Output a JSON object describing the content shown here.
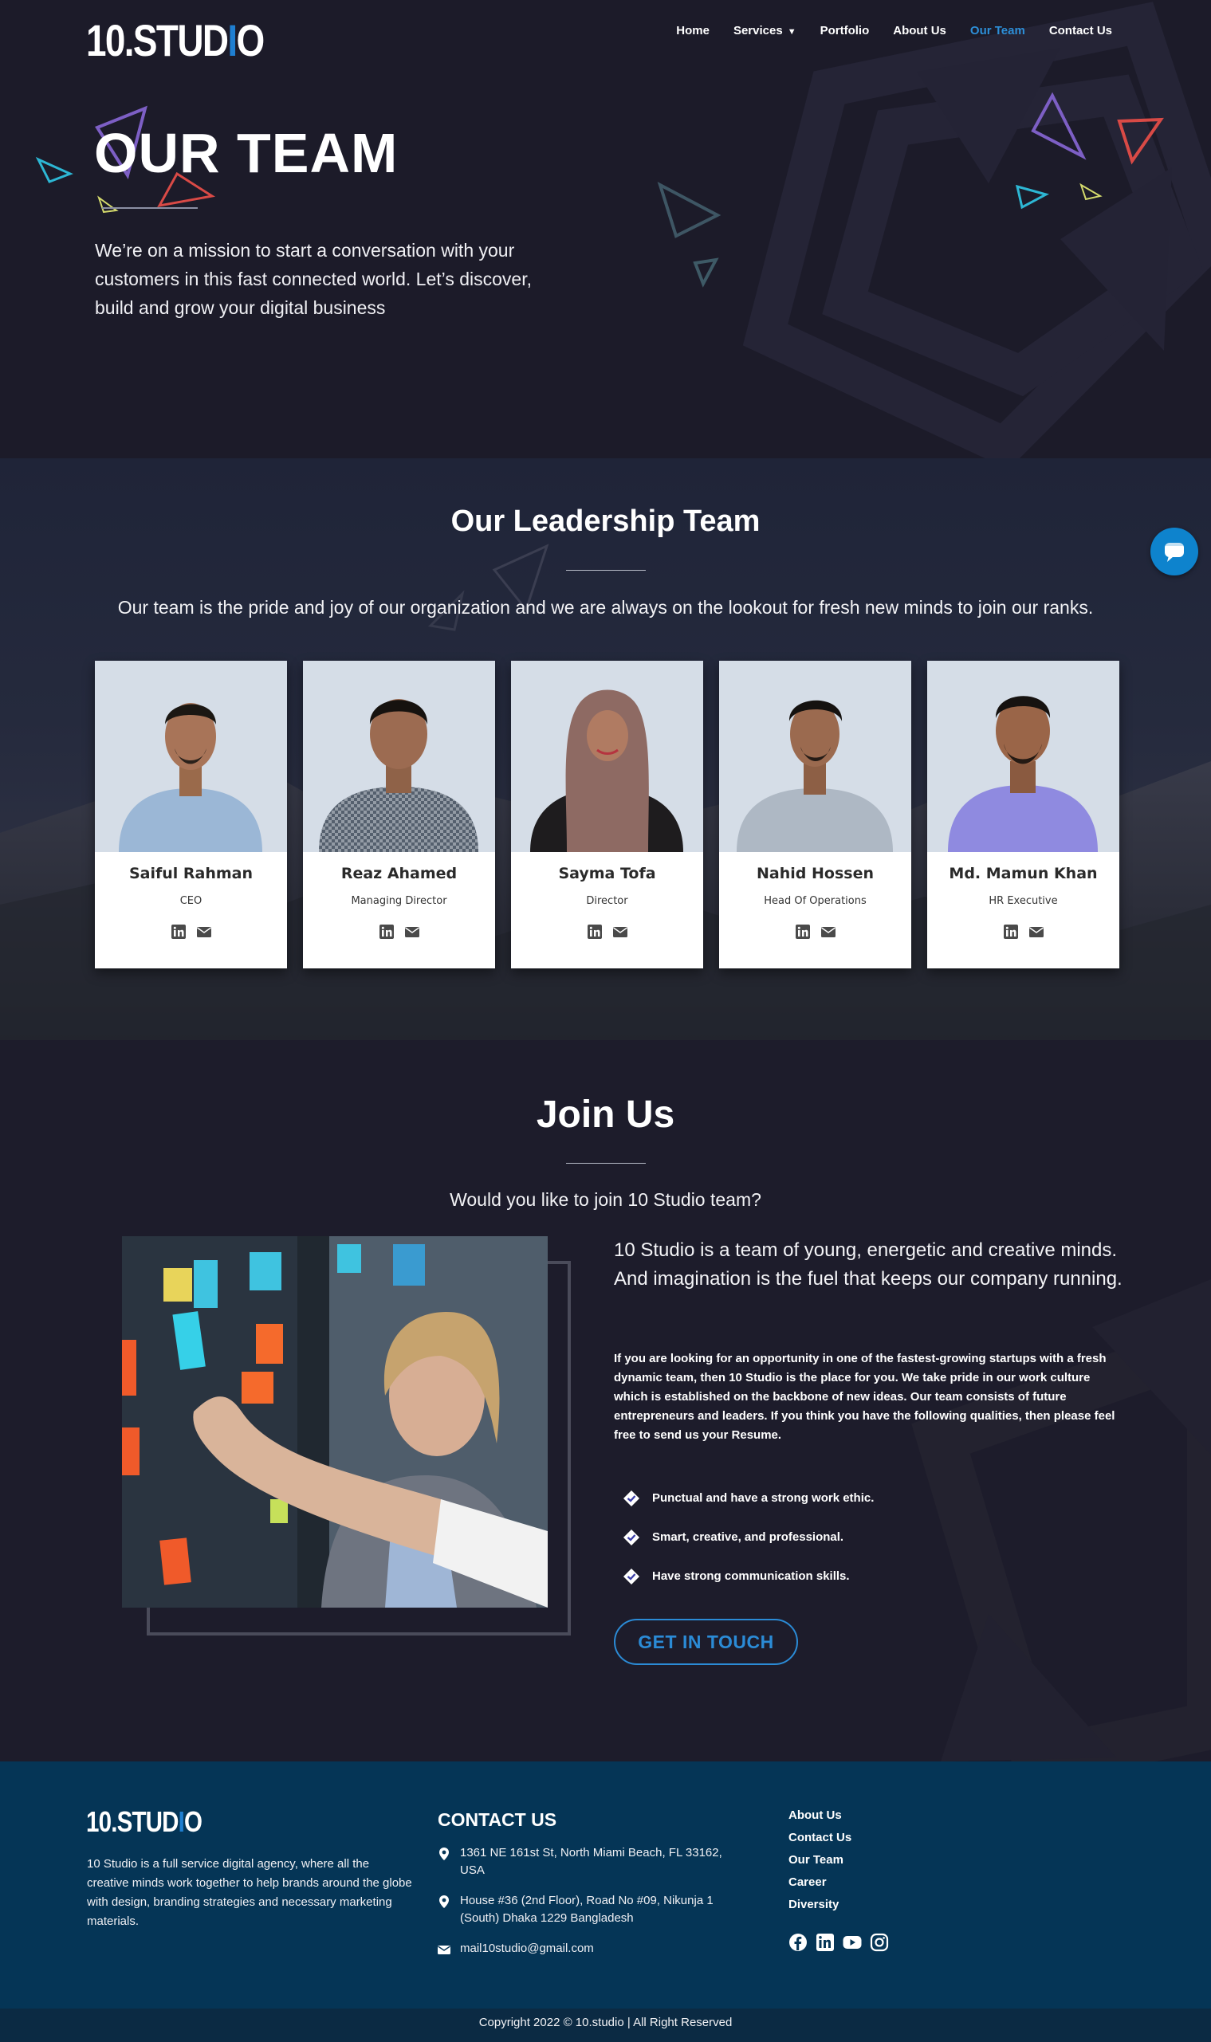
{
  "header": {
    "logo_text": "10.STUD",
    "logo_bar": "I",
    "logo_end": "O",
    "nav": [
      {
        "label": "Home",
        "active": false
      },
      {
        "label": "Services",
        "active": false
      },
      {
        "label": "Portfolio",
        "active": false
      },
      {
        "label": "About Us",
        "active": false
      },
      {
        "label": "Our Team",
        "active": true
      },
      {
        "label": "Contact Us",
        "active": false
      }
    ]
  },
  "hero": {
    "title": "OUR TEAM",
    "text": "We’re on a mission to start a conversation with your customers in this fast connected world. Let’s discover, build and grow your digital business"
  },
  "leadership": {
    "title": "Our Leadership Team",
    "subtitle": "Our team is the pride and joy of our organization and we are always on the lookout for fresh new minds to join our ranks.",
    "members": [
      {
        "name": "Saiful Rahman",
        "role": "CEO"
      },
      {
        "name": "Reaz Ahamed",
        "role": "Managing Director"
      },
      {
        "name": "Sayma Tofa",
        "role": "Director"
      },
      {
        "name": "Nahid Hossen",
        "role": "Head Of Operations"
      },
      {
        "name": "Md. Mamun Khan",
        "role": "HR Executive"
      }
    ]
  },
  "join": {
    "title": "Join Us",
    "subtitle": "Would you like to join 10 Studio team?",
    "lead": "10 Studio is a team of young, energetic and creative minds. And imagination is the fuel that keeps our company running.",
    "body": "If you are looking for an opportunity in one of the fastest-growing startups with a fresh dynamic team, then 10 Studio is the place for you. We take pride in our work culture which is established on the backbone of new ideas. Our team consists of future entrepreneurs and leaders. If you think you have the following qualities, then please feel free to send us your Resume.",
    "qualities": [
      "Punctual and have a strong work ethic.",
      "Smart, creative, and professional.",
      "Have strong communication skills."
    ],
    "cta": "GET IN TOUCH"
  },
  "footer": {
    "logo_text": "10.STUD",
    "logo_bar": "I",
    "logo_end": "O",
    "about": "10 Studio is a full service digital agency, where all the creative minds work together to help brands around the globe with design, branding strategies and necessary marketing materials.",
    "contact_title": "CONTACT US",
    "address1": "1361 NE 161st St, North Miami Beach, FL 33162, USA",
    "address2": "House #36 (2nd Floor), Road No #09, Nikunja 1 (South) Dhaka 1229 Bangladesh",
    "email": "mail10studio@gmail.com",
    "links": [
      "About Us",
      "Contact Us",
      "Our Team",
      "Career",
      "Diversity"
    ],
    "social": [
      "facebook-icon",
      "linkedin-icon",
      "youtube-icon",
      "instagram-icon"
    ],
    "copyright": "Copyright 2022 © 10.studio | All Right Reserved"
  },
  "colors": {
    "accent": "#2b8bd6",
    "hero_bg": "#1c1b29",
    "footer_bg": "#053556",
    "copyright_bg": "#0b2a43"
  }
}
